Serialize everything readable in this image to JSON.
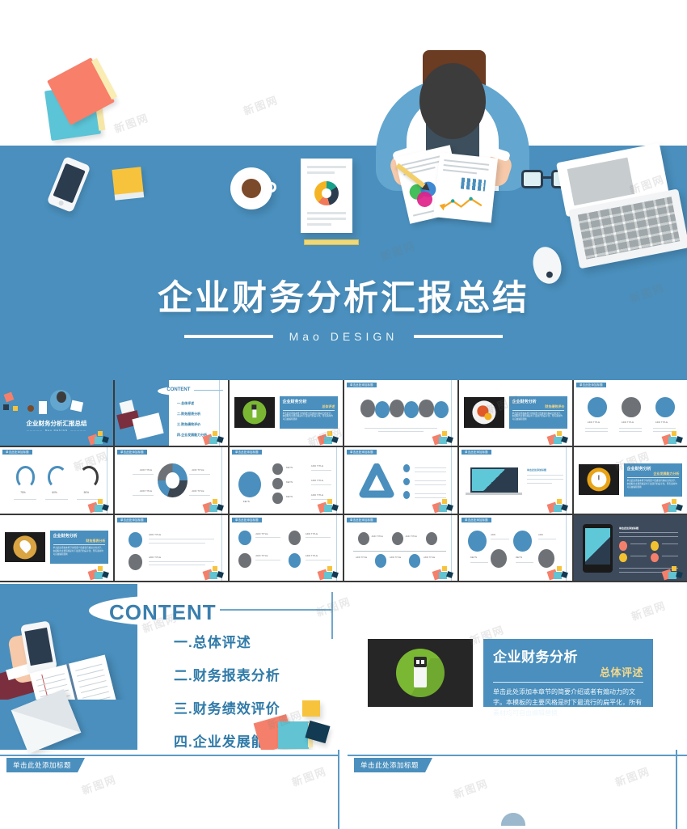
{
  "hero": {
    "title": "企业财务分析汇报总结",
    "subtitle": "Mao DESIGN",
    "bg_color": "#4a8fbd",
    "icons": {
      "books": "book-stack-icon",
      "phone": "smartphone-icon",
      "sticky": "sticky-note-icon",
      "coffee": "coffee-cup-icon",
      "document": "pie-chart-report-icon",
      "ruler": "ruler-icon",
      "person": "businessman-top-view-icon",
      "glasses": "eyeglasses-icon",
      "laptop": "laptop-icon",
      "mouse": "computer-mouse-icon",
      "pencil": "pencil-icon"
    }
  },
  "thumbnails": {
    "cover": {
      "title": "企业财务分析汇报总结",
      "subtitle": "Mao DESIGN"
    },
    "content": {
      "label": "CONTENT",
      "items": [
        "一.总体评述",
        "二.财务报表分析",
        "三.财务绩效评价",
        "四.企业发展能力分析"
      ]
    },
    "tag_label": "单击此处添加标题",
    "add_title": "ADD TITLE",
    "keys_label": "KEYS",
    "percents": [
      "75%",
      "60%",
      "50%"
    ],
    "section_slides": [
      {
        "heading": "企业财务分析",
        "sub": "总体评述",
        "icon": "usb-plug-icon",
        "icon_color": "#7ab833"
      },
      {
        "heading": "企业财务分析",
        "sub": "财务绩效评价",
        "icon": "gear-icon",
        "icon_color": "#e0592a"
      },
      {
        "heading": "企业财务分析",
        "sub": "企业发展能力分析",
        "icon": "clock-icon",
        "icon_color": "#e8a317"
      },
      {
        "heading": "企业财务分析",
        "sub": "财务报表分析",
        "icon": "location-pin-icon",
        "icon_color": "#d9a441"
      }
    ],
    "body_placeholder": "According to your needs to draw the text box table. Please specify the text box and move and set the printing manual template."
  },
  "content_slide": {
    "heading": "CONTENT",
    "items": [
      "一.总体评述",
      "二.财务报表分析",
      "三.财务绩效评价",
      "四.企业发展能力分析"
    ],
    "heading_color": "#3a7fae"
  },
  "section_slide": {
    "icon": "usb-plug-icon",
    "icon_color": "#7ab833",
    "heading": "企业财务分析",
    "sub_heading": "总体评述",
    "body": "单击此处添加本章节的简要介绍或者有煽动力的文字。本模板的主要风格是时下最流行的扁平化，所有素材均可自由编辑替换"
  },
  "bottom_strip": {
    "left_tag": "单击此处添加标题",
    "right_tag": "单击此处添加标题"
  },
  "watermark": {
    "text": "新图网"
  },
  "colors": {
    "primary_blue": "#4a8fbd",
    "text_blue": "#3a7fae",
    "accent_gold": "#f3d78b",
    "dark": "#262626"
  }
}
